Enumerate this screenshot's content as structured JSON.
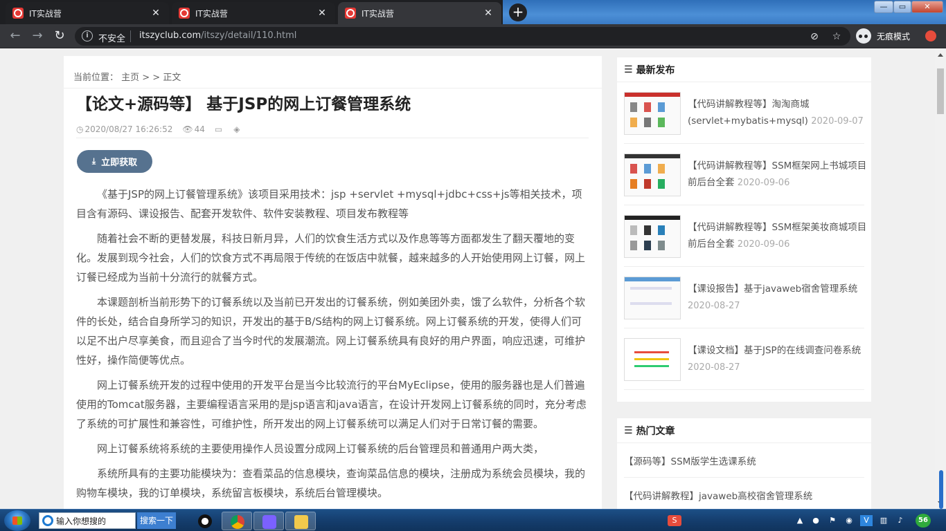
{
  "browser": {
    "tabs": [
      {
        "title": "IT实战营"
      },
      {
        "title": "IT实战营"
      },
      {
        "title": "IT实战营"
      }
    ],
    "omnibox": {
      "security": "不安全",
      "host": "itszyclub.com",
      "path": "/itszy/detail/110.html"
    },
    "incognito_label": "无痕模式"
  },
  "article": {
    "breadcrumb": "当前位置： 主页 > > 正文",
    "title": "【论文+源码等】 基于JSP的网上订餐管理系统",
    "datetime": "2020/08/27 16:26:52",
    "views": "44",
    "download_label": "立即获取",
    "paragraphs": [
      "《基于JSP的网上订餐管理系统》该项目采用技术：jsp +servlet +mysql+jdbc+css+js等相关技术，项目含有源码、课设报告、配套开发软件、软件安装教程、项目发布教程等",
      "随着社会不断的更替发展，科技日新月异，人们的饮食生活方式以及作息等等方面都发生了翻天覆地的变化。发展到现今社会，人们的饮食方式不再局限于传统的在饭店中就餐，越来越多的人开始使用网上订餐，网上订餐已经成为当前十分流行的就餐方式。",
      "本课题剖析当前形势下的订餐系统以及当前已开发出的订餐系统，例如美团外卖，饿了么软件，分析各个软件的长处，结合自身所学习的知识，开发出的基于B/S结构的网上订餐系统。网上订餐系统的开发，使得人们可以足不出户尽享美食，而且迎合了当今时代的发展潮流。网上订餐系统具有良好的用户界面，响应迅速，可维护性好，操作简便等优点。",
      "网上订餐系统开发的过程中使用的开发平台是当今比较流行的平台MyEclipse，使用的服务器也是人们普遍使用的Tomcat服务器，主要编程语言采用的是jsp语言和java语言，在设计开发网上订餐系统的同时，充分考虑了系统的可扩展性和兼容性，可维护性，所开发出的网上订餐系统可以满足人们对于日常订餐的需要。",
      "网上订餐系统将系统的主要使用操作人员设置分成网上订餐系统的后台管理员和普通用户两大类，",
      "系统所具有的主要功能模块为：查看菜品的信息模块，查询菜品信息的模块，注册成为系统会员模块，我的购物车模块，我的订单模块，系统留言板模块，系统后台管理模块。"
    ]
  },
  "sidebar": {
    "latest_title": "最新发布",
    "latest": [
      {
        "title": "【代码讲解教程等】淘淘商城(servlet+mybatis+mysql)",
        "date": "2020-09-07"
      },
      {
        "title": "【代码讲解教程等】SSM框架网上书城项目前后台全套",
        "date": "2020-09-06"
      },
      {
        "title": "【代码讲解教程等】SSM框架美妆商城项目前后台全套",
        "date": "2020-09-06"
      },
      {
        "title": "【课设报告】基于javaweb宿舍管理系统",
        "date": "2020-08-27"
      },
      {
        "title": "【课设文档】基于JSP的在线调查问卷系统",
        "date": "2020-08-27"
      }
    ],
    "hot_title": "热门文章",
    "hot": [
      {
        "title": "【源码等】SSM版学生选课系统"
      },
      {
        "title": "【代码讲解教程】javaweb高校宿舍管理系统"
      }
    ]
  },
  "taskbar": {
    "search_placeholder": "输入你想搜的",
    "search_button": "搜索一下",
    "tray_badge": "56"
  },
  "colors": {
    "accent_button": "#56728f",
    "chrome_dark": "#35363a"
  }
}
